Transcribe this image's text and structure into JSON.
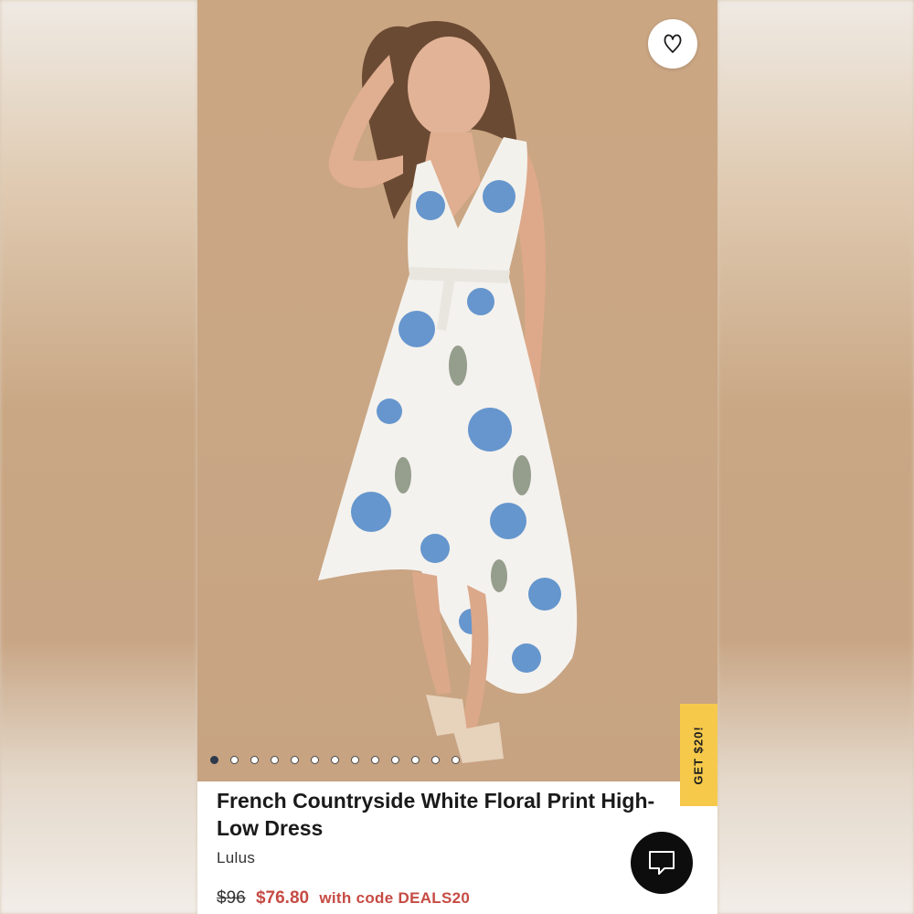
{
  "product": {
    "title": "French Countryside White Floral Print High-Low Dress",
    "brand": "Lulus",
    "price_original": "$96",
    "price_sale": "$76.80",
    "promo_code_text": "with code DEALS20"
  },
  "gallery": {
    "total_images": 13,
    "active_index": 0
  },
  "promo_tab": {
    "label": "GET $20!"
  },
  "icons": {
    "favorite": "heart-outline-icon",
    "chat": "chat-bubble-icon"
  },
  "colors": {
    "sale_price": "#c64b44",
    "promo_tab": "#f6c94b",
    "hero_background": "#c9a684",
    "chat_button": "#0d0d0d"
  }
}
